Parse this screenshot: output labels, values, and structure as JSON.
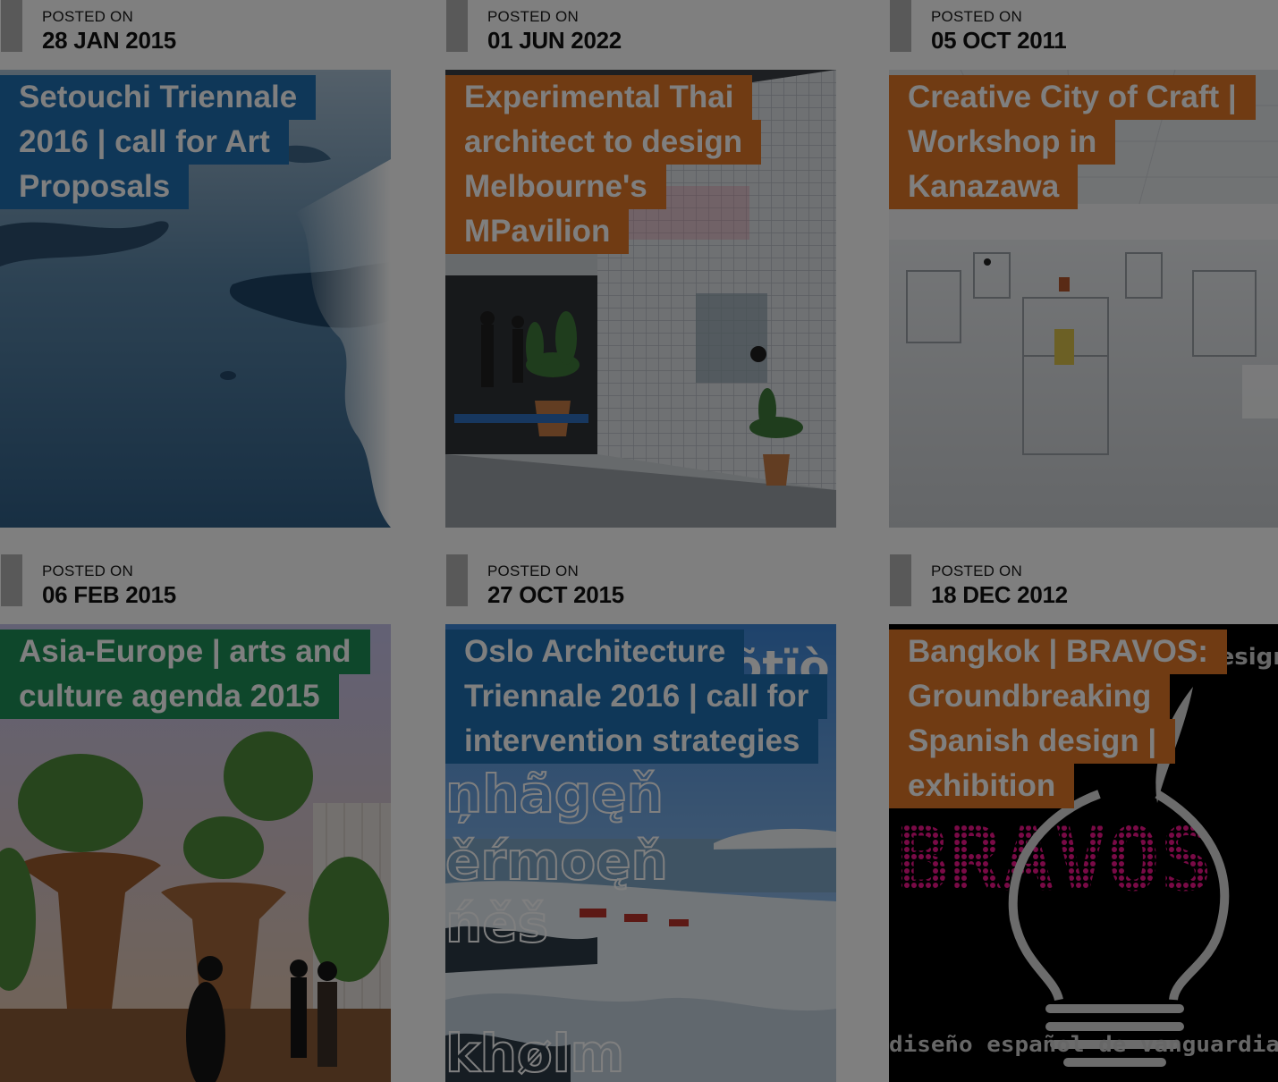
{
  "colors": {
    "blue": "#1f6fb0",
    "orange": "#e07726",
    "green": "#1c8f56"
  },
  "posts": [
    {
      "posted_label": "POSTED ON",
      "date": "28 JAN 2015",
      "title_lines": [
        "Setouchi Triennale",
        "2016 | call for Art",
        "Proposals"
      ],
      "tag_color": "blue",
      "image": "aerial-sea-islands-image"
    },
    {
      "posted_label": "POSTED ON",
      "date": "01 JUN 2022",
      "title_lines": [
        "Experimental Thai",
        "architect to design",
        "Melbourne's",
        "MPavilion"
      ],
      "tag_color": "orange",
      "image": "grid-pavilion-plants-image"
    },
    {
      "posted_label": "POSTED ON",
      "date": "05 OCT 2011",
      "title_lines": [
        "Creative City of Craft |",
        "Workshop in",
        "Kanazawa"
      ],
      "tag_color": "orange",
      "image": "white-gallery-exhibition-image"
    },
    {
      "posted_label": "POSTED ON",
      "date": "06 FEB 2015",
      "title_lines": [
        "Asia-Europe | arts and",
        "culture agenda 2015"
      ],
      "tag_color": "green",
      "image": "tree-sculptures-plaza-image"
    },
    {
      "posted_label": "POSTED ON",
      "date": "27 OCT 2015",
      "title_lines": [
        "Oslo Architecture",
        "Triennale 2016 | call for",
        "intervention strategies"
      ],
      "tag_color": "blue",
      "image": "arctic-landscape-poster-image",
      "poster_words": [
        "õtïò",
        "ņhãgęň",
        "ěŕmoęň",
        "ńěš",
        "khølm"
      ]
    },
    {
      "posted_label": "POSTED ON",
      "date": "18 DEC 2012",
      "title_lines": [
        "Bangkok | BRAVOS:",
        "Groundbreaking",
        "Spanish design |",
        "exhibition"
      ],
      "tag_color": "orange",
      "image": "bravos-lightbulb-poster-image",
      "poster_words": [
        "design",
        "BRAVOS",
        "diseño español de vanguardia"
      ]
    }
  ]
}
